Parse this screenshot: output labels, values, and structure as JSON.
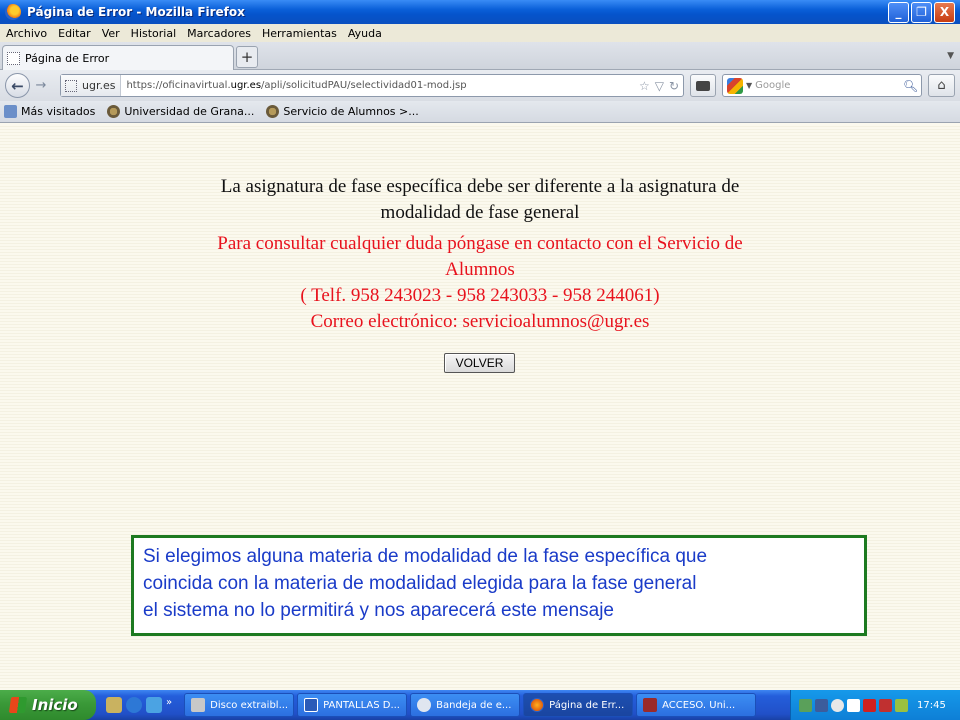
{
  "window": {
    "title": "Página de Error - Mozilla Firefox",
    "minimize": "_",
    "maximize": "❐",
    "close": "X"
  },
  "menu": [
    "Archivo",
    "Editar",
    "Ver",
    "Historial",
    "Marcadores",
    "Herramientas",
    "Ayuda"
  ],
  "tab": {
    "label": "Página de Error",
    "new_tab": "+"
  },
  "nav": {
    "identity": "ugr.es",
    "url_prefix": "https://oficinavirtual.",
    "url_domain": "ugr.es",
    "url_path": "/apli/solicitudPAU/selectividad01-mod.jsp",
    "search_placeholder": "Google"
  },
  "bookmarks": [
    "Más visitados",
    "Universidad de Grana...",
    "Servicio de Alumnos >..."
  ],
  "page": {
    "error_line1": "La asignatura de fase específica debe ser diferente a la asignatura de",
    "error_line2": "modalidad de fase general",
    "contact_line1": "Para consultar cualquier duda póngase en contacto con el Servicio de",
    "contact_line2": "Alumnos",
    "contact_line3": "( Telf. 958 243023 - 958 243033 - 958 244061)",
    "contact_line4": "Correo electrónico: servicioalumnos@ugr.es",
    "button": "VOLVER"
  },
  "callout": {
    "line1": "Si elegimos alguna materia de modalidad de la fase específica que",
    "line2": "coincida con la materia de modalidad elegida para la fase general",
    "line3": "el sistema no lo permitirá y nos aparecerá este mensaje"
  },
  "taskbar": {
    "start": "Inicio",
    "more": "»",
    "tasks": [
      "Disco extraibl...",
      "PANTALLAS D...",
      "Bandeja de e...",
      "Página de Err...",
      "ACCESO. Uni..."
    ],
    "clock": "17:45"
  },
  "colors": {
    "error_text": "#111111",
    "contact_text": "#e8121d",
    "callout_border": "#1d7a20",
    "callout_text": "#1a3bc8"
  }
}
